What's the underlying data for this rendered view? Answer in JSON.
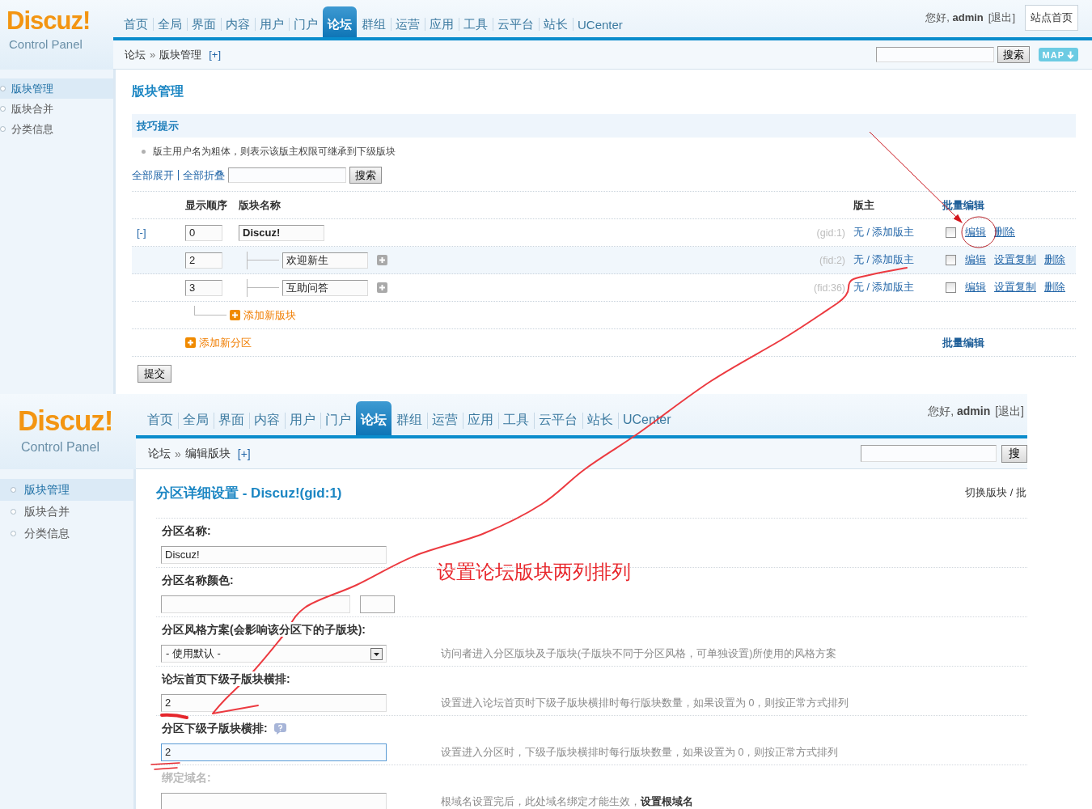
{
  "top_screen": {
    "logo": {
      "brand": "Discuz!",
      "subtitle": "Control Panel"
    },
    "nav_tabs": [
      {
        "label": "首页",
        "selected": false
      },
      {
        "label": "全局",
        "selected": false
      },
      {
        "label": "界面",
        "selected": false
      },
      {
        "label": "内容",
        "selected": false
      },
      {
        "label": "用户",
        "selected": false
      },
      {
        "label": "门户",
        "selected": false
      },
      {
        "label": "论坛",
        "selected": true
      },
      {
        "label": "群组",
        "selected": false
      },
      {
        "label": "运营",
        "selected": false
      },
      {
        "label": "应用",
        "selected": false
      },
      {
        "label": "工具",
        "selected": false
      },
      {
        "label": "云平台",
        "selected": false
      },
      {
        "label": "站长",
        "selected": false
      },
      {
        "label": "UCenter",
        "selected": false
      }
    ],
    "greeting": "您好, **admin**",
    "logout": "[退出]",
    "site_home": "站点首页",
    "breadcrumb": {
      "items": [
        "论坛",
        "版块管理"
      ],
      "separator": "»",
      "add": "[+]"
    },
    "search_button": "搜索",
    "map_button": "MAP",
    "sidebar": [
      {
        "label": "版块管理",
        "selected": true
      },
      {
        "label": "版块合并",
        "selected": false
      },
      {
        "label": "分类信息",
        "selected": false
      }
    ],
    "title": "版块管理",
    "tips_title": "技巧提示",
    "tips": [
      "版主用户名为粗体，则表示该版主权限可继承到下级版块"
    ],
    "expand_all": "全部展开",
    "collapse_all": "全部折叠",
    "filter_button": "搜索",
    "columns": [
      "显示顺序",
      "版块名称",
      "版主",
      "批量编辑"
    ],
    "rows": [
      {
        "kind": "category",
        "toggle": "[-]",
        "order": "0",
        "name": "Discuz!",
        "id_label": "(gid:1)",
        "moderator": "无 / 添加版主",
        "hovered": false,
        "checked": false,
        "actions": [
          "编辑",
          "删除"
        ]
      },
      {
        "kind": "forum",
        "order": "2",
        "name": "欢迎新生",
        "id_label": "(fid:2)",
        "moderator": "无 / 添加版主",
        "hovered": true,
        "checked": false,
        "actions": [
          "编辑",
          "设置复制",
          "删除"
        ]
      },
      {
        "kind": "forum",
        "order": "3",
        "name": "互助问答",
        "id_label": "(fid:36)",
        "moderator": "无 / 添加版主",
        "hovered": false,
        "checked": false,
        "actions": [
          "编辑",
          "设置复制",
          "删除"
        ]
      }
    ],
    "add_forum": "添加新版块",
    "add_category": "添加新分区",
    "batch_edit": "批量编辑",
    "submit": "提交"
  },
  "bottom_screen": {
    "logo": {
      "brand": "Discuz!",
      "subtitle": "Control Panel"
    },
    "nav_tabs": [
      {
        "label": "首页",
        "selected": false
      },
      {
        "label": "全局",
        "selected": false
      },
      {
        "label": "界面",
        "selected": false
      },
      {
        "label": "内容",
        "selected": false
      },
      {
        "label": "用户",
        "selected": false
      },
      {
        "label": "门户",
        "selected": false
      },
      {
        "label": "论坛",
        "selected": true
      },
      {
        "label": "群组",
        "selected": false
      },
      {
        "label": "运营",
        "selected": false
      },
      {
        "label": "应用",
        "selected": false
      },
      {
        "label": "工具",
        "selected": false
      },
      {
        "label": "云平台",
        "selected": false
      },
      {
        "label": "站长",
        "selected": false
      },
      {
        "label": "UCenter",
        "selected": false
      }
    ],
    "greeting": "您好, **admin**",
    "logout": "[退出]",
    "breadcrumb": {
      "items": [
        "论坛",
        "编辑版块"
      ],
      "separator": "»",
      "add": "[+]"
    },
    "search_button": "搜",
    "sidebar": [
      {
        "label": "版块管理",
        "selected": true
      },
      {
        "label": "版块合并",
        "selected": false
      },
      {
        "label": "分类信息",
        "selected": false
      }
    ],
    "title": "分区详细设置 - Discuz!(gid:1)",
    "switch_link": "切换版块 / 批",
    "fields": [
      {
        "kind": "text",
        "label": "分区名称:",
        "value": "Discuz!",
        "help": false,
        "focused": false,
        "disabled": false
      },
      {
        "kind": "color",
        "label": "分区名称颜色:",
        "help": false,
        "focused": false,
        "disabled": false
      },
      {
        "kind": "select",
        "label": "分区风格方案(会影响该分区下的子版块):",
        "value": "- 使用默认 -",
        "hint": "访问者进入分区版块及子版块(子版块不同于分区风格，可单独设置)所使用的风格方案",
        "help": false,
        "focused": false,
        "disabled": false
      },
      {
        "kind": "text",
        "label": "论坛首页下级子版块横排:",
        "value": "2",
        "hint": "设置进入论坛首页时下级子版块横排时每行版块数量，如果设置为 0，则按正常方式排列",
        "help": false,
        "focused": false,
        "disabled": false
      },
      {
        "kind": "text",
        "label": "分区下级子版块横排:",
        "value": "2",
        "hint": "设置进入分区时，下级子版块横排时每行版块数量，如果设置为 0，则按正常方式排列",
        "help": true,
        "focused": true,
        "disabled": false
      },
      {
        "kind": "text",
        "label": "绑定域名:",
        "hint": "根域名设置完后，此处域名绑定才能生效，",
        "hint_link": "设置根域名",
        "help": false,
        "focused": false,
        "disabled": true
      }
    ]
  },
  "annotation": {
    "note": "设置论坛版块两列排列"
  }
}
